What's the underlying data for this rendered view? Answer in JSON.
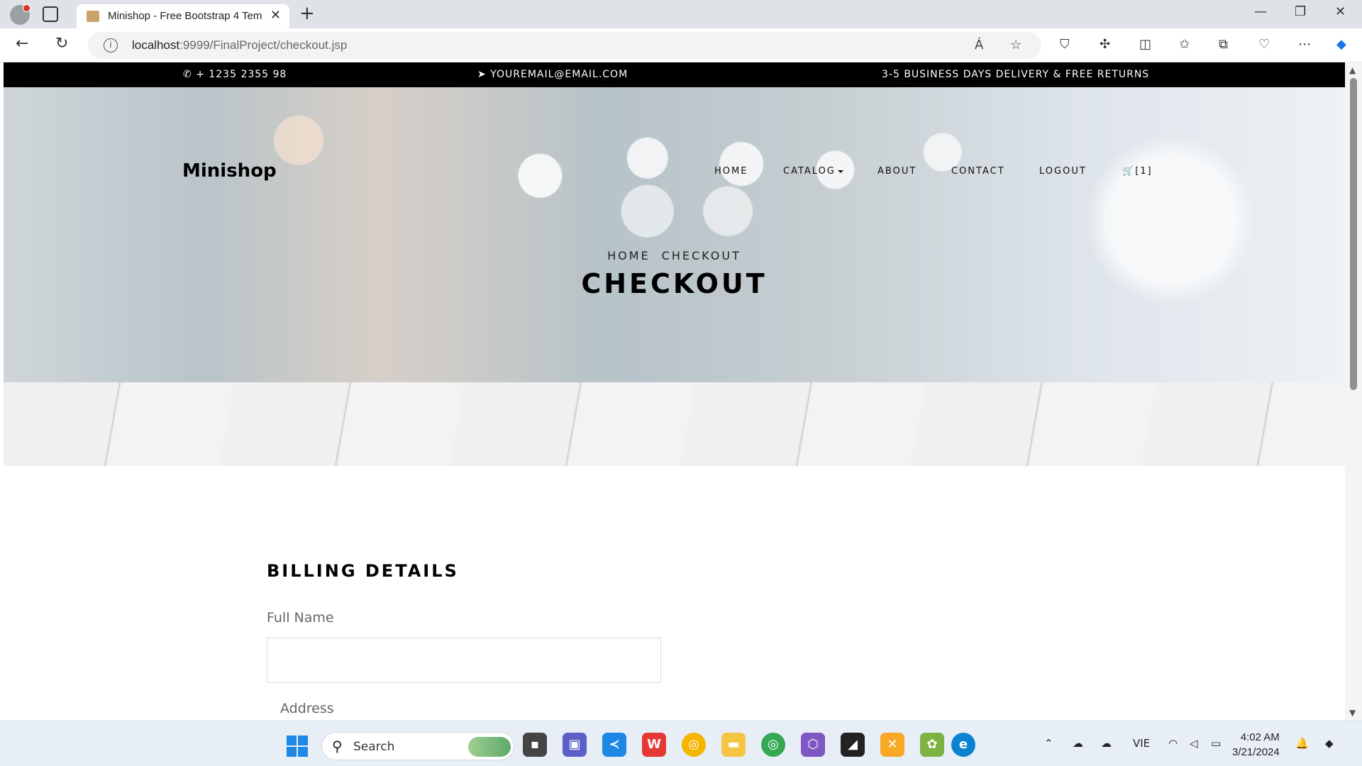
{
  "browser": {
    "tab_title": "Minishop - Free Bootstrap 4 Tem",
    "url_host": "localhost",
    "url_path": ":9999/FinalProject/checkout.jsp",
    "read_aloud": "Á"
  },
  "topbar": {
    "phone": "+ 1235 2355 98",
    "email": "YOUREMAIL@EMAIL.COM",
    "shipping": "3-5 BUSINESS DAYS DELIVERY & FREE RETURNS"
  },
  "header": {
    "brand": "Minishop",
    "nav": {
      "home": "HOME",
      "catalog": "CATALOG",
      "about": "ABOUT",
      "contact": "CONTACT",
      "logout": "LOGOUT",
      "cart": "[1]"
    }
  },
  "hero": {
    "crumb_home": "HOME",
    "crumb_current": "CHECKOUT",
    "title": "CHECKOUT"
  },
  "billing": {
    "title": "BILLING DETAILS",
    "full_name_label": "Full Name",
    "full_name_value": "",
    "address_label": "Address"
  },
  "taskbar": {
    "search_label": "Search",
    "language": "VIE",
    "time": "4:02 AM",
    "date": "3/21/2024"
  }
}
